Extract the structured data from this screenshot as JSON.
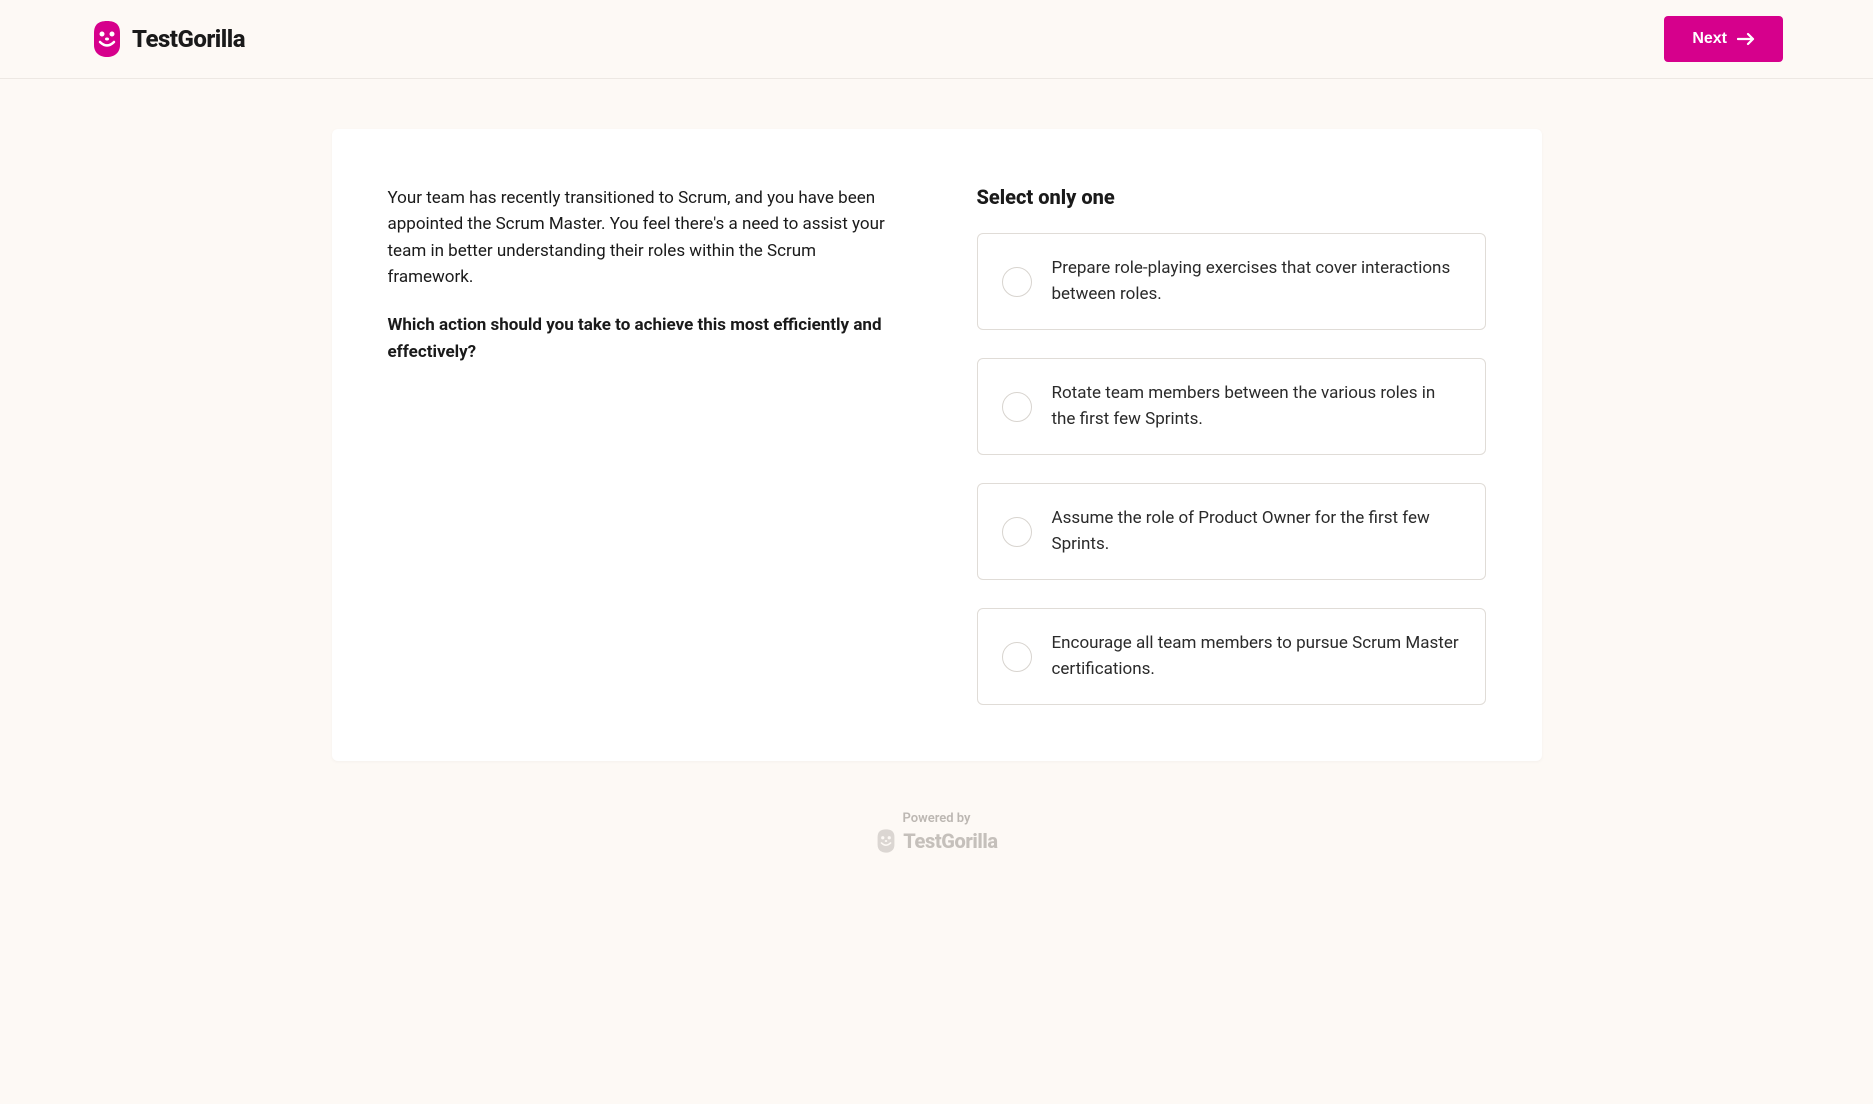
{
  "header": {
    "brand_name": "TestGorilla",
    "next_label": "Next"
  },
  "question": {
    "context": "Your team has recently transitioned to Scrum, and you have been appointed the Scrum Master. You feel there's a need to assist your team in better understanding their roles within the Scrum framework.",
    "prompt": "Which action should you take to achieve this most efficiently and effectively?"
  },
  "answers": {
    "heading": "Select only one",
    "options": [
      "Prepare role-playing exercises that cover interactions between roles.",
      "Rotate team members between the various roles in the first few Sprints.",
      "Assume the role of Product Owner for the first few Sprints.",
      "Encourage all team members to pursue Scrum Master certifications."
    ]
  },
  "footer": {
    "powered_by": "Powered by",
    "brand_name": "TestGorilla"
  },
  "colors": {
    "primary": "#d6008c",
    "background": "#fdf9f5",
    "card": "#ffffff",
    "text": "#1a1a1a",
    "border": "#e0dcd7"
  }
}
